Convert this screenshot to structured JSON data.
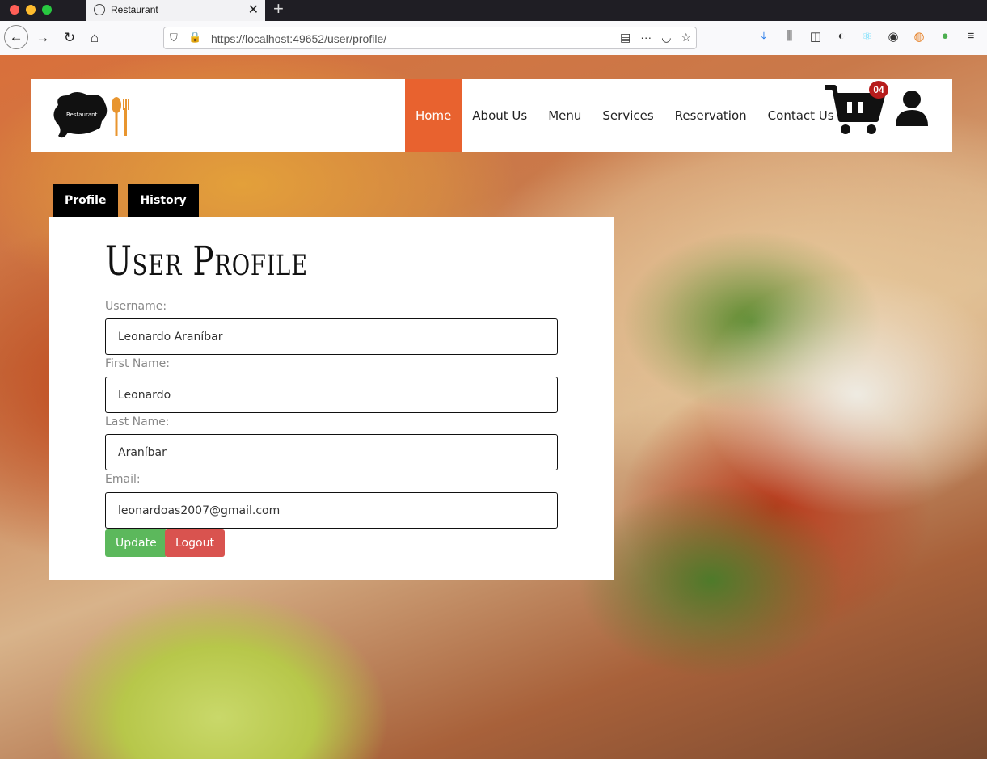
{
  "browser": {
    "tab_title": "Restaurant",
    "url": "https://localhost:49652/user/profile/"
  },
  "site": {
    "logo_text": "Restaurant",
    "nav": [
      "Home",
      "About Us",
      "Menu",
      "Services",
      "Reservation",
      "Contact Us"
    ],
    "active_nav": "Home",
    "cart_count": "04",
    "accent_color": "#e8622f"
  },
  "profile": {
    "tabs": [
      "Profile",
      "History"
    ],
    "title": "User Profile",
    "fields": [
      {
        "label": "Username:",
        "value": "Leonardo Araníbar"
      },
      {
        "label": "First Name:",
        "value": "Leonardo"
      },
      {
        "label": "Last Name:",
        "value": "Araníbar"
      },
      {
        "label": "Email:",
        "value": "leonardoas2007@gmail.com"
      }
    ],
    "update_label": "Update",
    "logout_label": "Logout"
  }
}
